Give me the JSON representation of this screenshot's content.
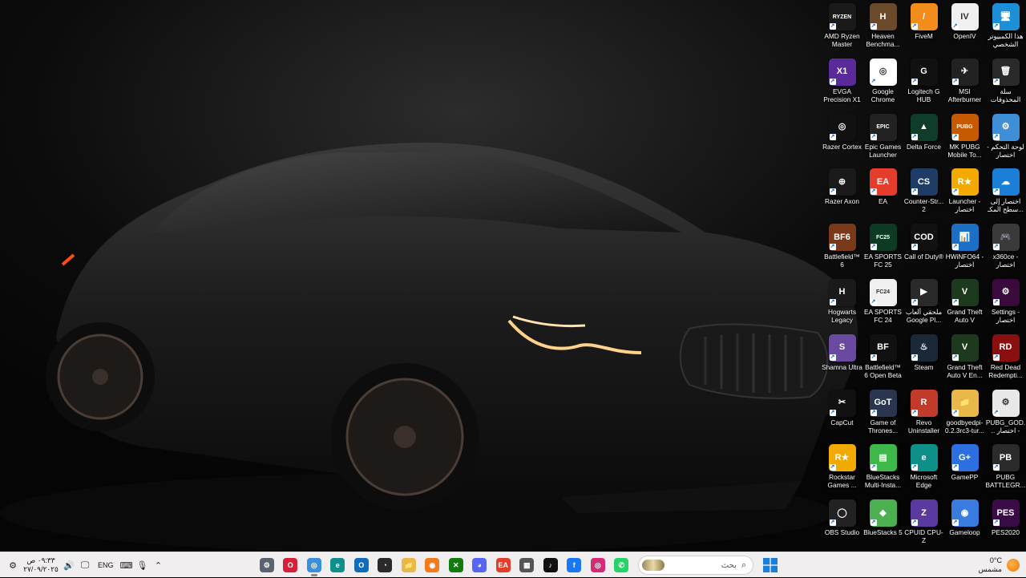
{
  "desktop": {
    "icons": [
      {
        "label": "هذا الكمبيوتر الشخصي",
        "icon": "this-pc-icon",
        "color": "#1d8fd6",
        "glyph": "🖥"
      },
      {
        "label": "سلة المحذوفات",
        "icon": "recycle-bin-icon",
        "color": "#2a2a2a",
        "glyph": "🗑"
      },
      {
        "label": "لوحة التحكم - اختصار",
        "icon": "control-panel-icon",
        "color": "#3f8ed8",
        "glyph": "⚙"
      },
      {
        "label": "اختصار إلى سطح المكـ...",
        "icon": "onedrive-icon",
        "color": "#1b7fd8",
        "glyph": "☁"
      },
      {
        "label": "x360ce - اختصار",
        "icon": "gamepad-icon",
        "color": "#3a3a3a",
        "glyph": "🎮"
      },
      {
        "label": "Settings - اختصار",
        "icon": "settings-shortcut-icon",
        "color": "#3a0a3c",
        "glyph": "⚙"
      },
      {
        "label": "Red Dead Redempti...",
        "icon": "red-dead-icon",
        "color": "#8a1010",
        "glyph": "RD"
      },
      {
        "label": "PUBG_GOD... اختصار -",
        "icon": "pubg-file-icon",
        "color": "#e8e8e8",
        "glyph": "⚙"
      },
      {
        "label": "PUBG BATTLEGR...",
        "icon": "pubg-icon",
        "color": "#2b2b2b",
        "glyph": "PB"
      },
      {
        "label": "PES2020",
        "icon": "pes2020-icon",
        "color": "#3b0b48",
        "glyph": "PES"
      },
      {
        "label": "OpenIV",
        "icon": "openiv-icon",
        "color": "#f0f0f0",
        "glyph": "IV"
      },
      {
        "label": "MSI Afterburner",
        "icon": "msi-afterburner-icon",
        "color": "#222",
        "glyph": "✈"
      },
      {
        "label": "MK PUBG Mobile To...",
        "icon": "mk-pubg-icon",
        "color": "#c65a00",
        "glyph": "PUBG"
      },
      {
        "label": "Launcher - اختصار",
        "icon": "rockstar-launcher-icon",
        "color": "#f2a900",
        "glyph": "R★"
      },
      {
        "label": "HWiNFO64 - اختصار",
        "icon": "hwinfo-icon",
        "color": "#1b6fc5",
        "glyph": "📊"
      },
      {
        "label": "Grand Theft Auto V",
        "icon": "gta-v-icon",
        "color": "#1e3a1e",
        "glyph": "V"
      },
      {
        "label": "Grand Theft Auto V En...",
        "icon": "gta-v-enhanced-icon",
        "color": "#1e3a1e",
        "glyph": "V"
      },
      {
        "label": "goodbyedpi-0.2.3rc3-tur...",
        "icon": "folder-icon",
        "color": "#e8b84a",
        "glyph": "📁"
      },
      {
        "label": "GamePP",
        "icon": "gamepp-icon",
        "color": "#2d6fe0",
        "glyph": "G+"
      },
      {
        "label": "Gameloop",
        "icon": "gameloop-icon",
        "color": "#3a7be0",
        "glyph": "◉"
      },
      {
        "label": "FiveM",
        "icon": "fivem-icon",
        "color": "#f28c1b",
        "glyph": "/"
      },
      {
        "label": "Logitech G HUB",
        "icon": "logitech-icon",
        "color": "#111",
        "glyph": "G"
      },
      {
        "label": "Delta Force",
        "icon": "delta-force-icon",
        "color": "#0f3d2a",
        "glyph": "▲"
      },
      {
        "label": "Counter-Str... 2",
        "icon": "counter-strike-icon",
        "color": "#1f3c66",
        "glyph": "CS"
      },
      {
        "label": "Call of Duty®",
        "icon": "call-of-duty-icon",
        "color": "#111",
        "glyph": "COD"
      },
      {
        "label": "ملحقي ألعاب Google Pl...",
        "icon": "google-play-games-icon",
        "color": "#2a2a2a",
        "glyph": "▶"
      },
      {
        "label": "Steam",
        "icon": "steam-icon",
        "color": "#1b2838",
        "glyph": "♨"
      },
      {
        "label": "Revo Uninstaller",
        "icon": "revo-uninstaller-icon",
        "color": "#c23a2a",
        "glyph": "R"
      },
      {
        "label": "Microsoft Edge",
        "icon": "edge-icon",
        "color": "#0f8f8a",
        "glyph": "e"
      },
      {
        "label": "CPUID CPU-Z",
        "icon": "cpu-z-icon",
        "color": "#5b3aa0",
        "glyph": "Z"
      },
      {
        "label": "Heaven Benchma...",
        "icon": "heaven-benchmark-icon",
        "color": "#6a4a2a",
        "glyph": "H"
      },
      {
        "label": "Google Chrome",
        "icon": "chrome-icon",
        "color": "#fff",
        "glyph": "◎"
      },
      {
        "label": "Epic Games Launcher",
        "icon": "epic-games-icon",
        "color": "#222",
        "glyph": "EPIC"
      },
      {
        "label": "EA",
        "icon": "ea-icon",
        "color": "#e53d2b",
        "glyph": "EA"
      },
      {
        "label": "EA SPORTS FC 25",
        "icon": "fc25-icon",
        "color": "#0c3a22",
        "glyph": "FC25"
      },
      {
        "label": "EA SPORTS FC 24",
        "icon": "fc24-icon",
        "color": "#f0f0f0",
        "glyph": "FC24"
      },
      {
        "label": "Battlefield™ 6 Open Beta",
        "icon": "battlefield-beta-icon",
        "color": "#111",
        "glyph": "BF"
      },
      {
        "label": "Game of Thrones...",
        "icon": "game-of-thrones-icon",
        "color": "#2a3650",
        "glyph": "GoT"
      },
      {
        "label": "BlueStacks Multi-Insta...",
        "icon": "bluestacks-multi-icon",
        "color": "#3fb84a",
        "glyph": "▤"
      },
      {
        "label": "BlueStacks 5",
        "icon": "bluestacks-icon",
        "color": "#4caf50",
        "glyph": "◆"
      },
      {
        "label": "AMD Ryzen Master",
        "icon": "ryzen-master-icon",
        "color": "#1a1a1a",
        "glyph": "RYZEN"
      },
      {
        "label": "EVGA Precision X1",
        "icon": "evga-icon",
        "color": "#5a2a9a",
        "glyph": "X1"
      },
      {
        "label": "Razer Cortex",
        "icon": "razer-cortex-icon",
        "color": "#111",
        "glyph": "◎"
      },
      {
        "label": "Razer Axon",
        "icon": "razer-axon-icon",
        "color": "#1a1a1a",
        "glyph": "⊕"
      },
      {
        "label": "Battlefield™ 6",
        "icon": "battlefield-icon",
        "color": "#7a3a1a",
        "glyph": "BF6"
      },
      {
        "label": "Hogwarts Legacy",
        "icon": "hogwarts-icon",
        "color": "#1a1a1a",
        "glyph": "H"
      },
      {
        "label": "Shamna Ultra",
        "icon": "shamna-icon",
        "color": "#6a4aa0",
        "glyph": "S"
      },
      {
        "label": "CapCut",
        "icon": "capcut-icon",
        "color": "#111",
        "glyph": "✂"
      },
      {
        "label": "Rockstar Games ...",
        "icon": "rockstar-games-icon",
        "color": "#f2a900",
        "glyph": "R★"
      },
      {
        "label": "OBS Studio",
        "icon": "obs-icon",
        "color": "#222",
        "glyph": "◯"
      }
    ]
  },
  "taskbar": {
    "clock_time": "٠٩:٣٣ ص",
    "clock_date": "٢٧/٠٩/٢٠٢٥",
    "language": "ENG",
    "search_placeholder": "بحث",
    "weather_temp": "0°C",
    "weather_desc": "مشمس",
    "tray_icons": [
      {
        "name": "settings-tray-icon",
        "glyph": "⚙"
      },
      {
        "name": "volume-icon",
        "glyph": "🔊"
      },
      {
        "name": "network-icon",
        "glyph": "🖵"
      },
      {
        "name": "keyboard-icon",
        "glyph": "⌨"
      },
      {
        "name": "microphone-icon",
        "glyph": "🎙"
      },
      {
        "name": "chevron-up-icon",
        "glyph": "⌃"
      }
    ],
    "pinned_apps": [
      {
        "name": "settings-app-icon",
        "color": "#5a6470",
        "glyph": "⚙",
        "active": false
      },
      {
        "name": "opera-gx-icon",
        "color": "#d6203a",
        "glyph": "O",
        "active": false
      },
      {
        "name": "chrome-taskbar-icon",
        "color": "#3a8ee0",
        "glyph": "◎",
        "active": true
      },
      {
        "name": "edge-taskbar-icon",
        "color": "#0f8f8a",
        "glyph": "e",
        "active": false
      },
      {
        "name": "outlook-icon",
        "color": "#0f6cbd",
        "glyph": "O",
        "active": false
      },
      {
        "name": "speedtest-icon",
        "color": "#2a2a2a",
        "glyph": "◔",
        "active": false
      },
      {
        "name": "file-explorer-icon",
        "color": "#e8b84a",
        "glyph": "📁",
        "active": false
      },
      {
        "name": "origin-icon",
        "color": "#f27a1a",
        "glyph": "◉",
        "active": false
      },
      {
        "name": "xbox-icon",
        "color": "#107c10",
        "glyph": "✕",
        "active": false
      },
      {
        "name": "discord-icon",
        "color": "#5865f2",
        "glyph": "◕",
        "active": false
      },
      {
        "name": "ea-app-icon",
        "color": "#e53d2b",
        "glyph": "EA",
        "active": false
      },
      {
        "name": "microsoft-store-icon",
        "color": "#555",
        "glyph": "▦",
        "active": false
      },
      {
        "name": "tiktok-icon",
        "color": "#111",
        "glyph": "♪",
        "active": false
      },
      {
        "name": "facebook-icon",
        "color": "#1877f2",
        "glyph": "f",
        "active": false
      },
      {
        "name": "instagram-icon",
        "color": "#d62976",
        "glyph": "◎",
        "active": false
      },
      {
        "name": "whatsapp-icon",
        "color": "#25d366",
        "glyph": "✆",
        "active": false
      }
    ]
  }
}
